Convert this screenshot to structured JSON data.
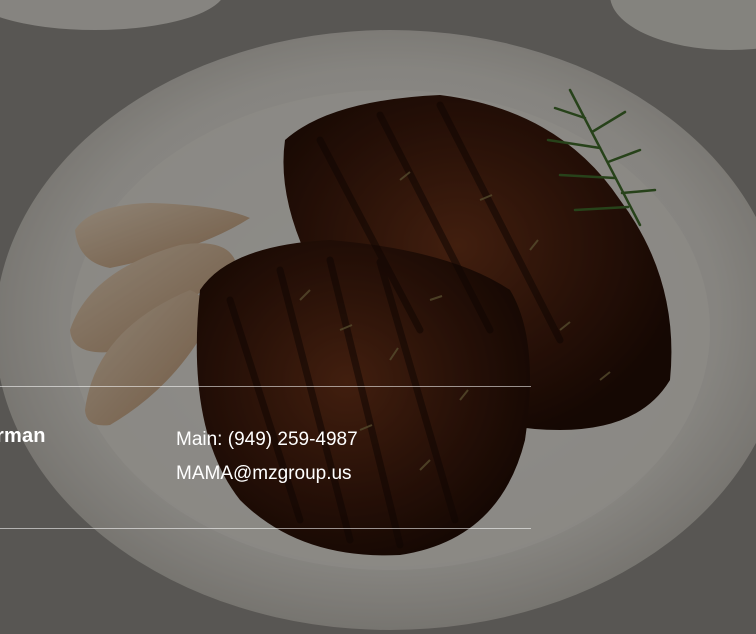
{
  "contact": {
    "name_fragment": "rman",
    "phone_label": "Main: (949) 259-4987",
    "email": "MAMA@mzgroup.us"
  },
  "background": {
    "subject": "grilled-chicken-plate-photo"
  }
}
